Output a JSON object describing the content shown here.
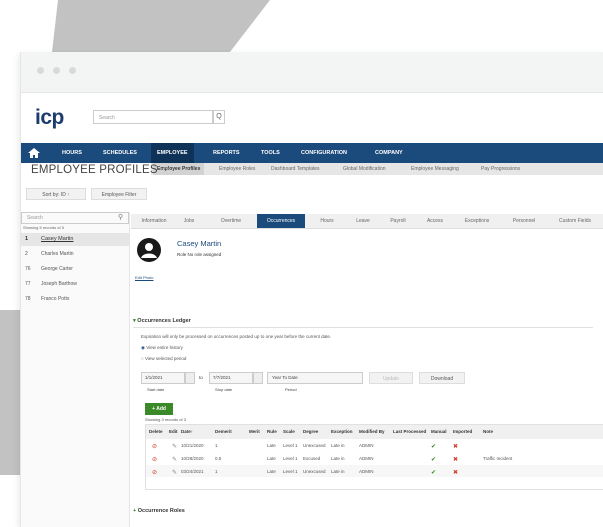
{
  "window": {
    "search_placeholder": "Search",
    "search_icon_char": "Q"
  },
  "logo": {
    "text": "icp"
  },
  "nav": {
    "items": [
      "HOURS",
      "SCHEDULES",
      "EMPLOYEE",
      "REPORTS",
      "TOOLS",
      "CONFIGURATION",
      "COMPANY"
    ]
  },
  "subnav": {
    "items": [
      "Employee Profiles",
      "Employee Roles",
      "Dashboard Templates",
      "Global Modification",
      "Employee Messaging",
      "Pay Progressions"
    ]
  },
  "page": {
    "title": "EMPLOYEE PROFILES",
    "sort_label": "Sort by: ID ↑",
    "filter_label": "Employee Filter"
  },
  "sidebar": {
    "search_placeholder": "Search",
    "showing": "Showing 5 records of 5",
    "rows": [
      {
        "id": "1",
        "name": "Casey Martin"
      },
      {
        "id": "2",
        "name": "Charles Martin"
      },
      {
        "id": "76",
        "name": "George Carter"
      },
      {
        "id": "77",
        "name": "Joseph Barthow"
      },
      {
        "id": "78",
        "name": "Franco Potts"
      }
    ]
  },
  "tabs": [
    "Information",
    "Jobs",
    "Overtime",
    "Occurrences",
    "Hours",
    "Leave",
    "Payroll",
    "Access",
    "Exceptions",
    "Personnel",
    "Custom Fields"
  ],
  "profile": {
    "name": "Casey Martin",
    "role": "Role No role assigned",
    "edit_photo": "Edit Photo"
  },
  "ledger": {
    "title": "Occurrences Ledger",
    "note": "Expiration will only be processed on occurrences posted up to one year before the current date.",
    "radio_all": "View entire history",
    "radio_period": "View selected period",
    "start_date": "1/1/2021",
    "to": "to",
    "stop_date": "7/7/2021",
    "period": "Year To Date",
    "update": "Update",
    "download": "Download",
    "start_label": "Start date",
    "stop_label": "Stop date",
    "period_label": "Period",
    "add": "+ Add",
    "showing": "Showing 3 records of 3",
    "columns": [
      "Delete",
      "Edit",
      "Date↑",
      "Demerit",
      "Merit",
      "Rule",
      "Scale",
      "Degree",
      "Exception",
      "Modified By",
      "Last Processed",
      "Manual",
      "Imported",
      "Note"
    ],
    "rows": [
      {
        "date": "10/21/2020",
        "demerit": "1",
        "merit": "",
        "rule": "Late",
        "scale": "Level 1",
        "degree": "Unexcused",
        "exception": "Late in",
        "modified": "ADMIN",
        "processed": "",
        "manual": "✔",
        "imported": "✖",
        "note": ""
      },
      {
        "date": "10/28/2020",
        "demerit": "0.5",
        "merit": "",
        "rule": "Late",
        "scale": "Level 1",
        "degree": "Excused",
        "exception": "Late in",
        "modified": "ADMIN",
        "processed": "",
        "manual": "✔",
        "imported": "✖",
        "note": "Traffic Incident"
      },
      {
        "date": "03/24/2021",
        "demerit": "1",
        "merit": "",
        "rule": "Late",
        "scale": "Level 1",
        "degree": "Unexcused",
        "exception": "Late in",
        "modified": "ADMIN",
        "processed": "",
        "manual": "✔",
        "imported": "✖",
        "note": ""
      }
    ]
  },
  "roles": {
    "title": "Occurrence Roles"
  },
  "colors": {
    "nav": "#1b4a7c",
    "nav_active": "#0f3358",
    "add_button": "#3a8a2a",
    "decor_gray": "#c2c2c2"
  }
}
